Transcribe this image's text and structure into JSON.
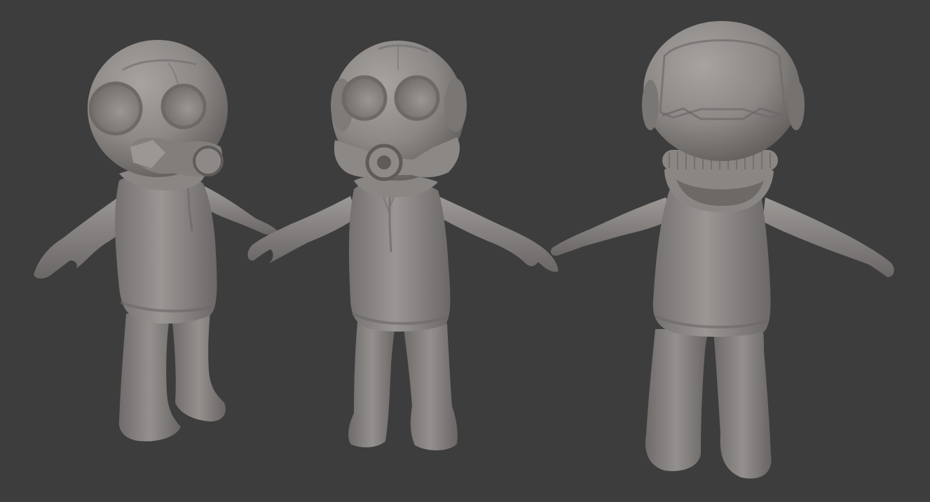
{
  "viewport": {
    "background": "#3d3d3d",
    "material_color": "#8f8b89"
  },
  "figures": [
    {
      "view": "three-quarter-left"
    },
    {
      "view": "front"
    },
    {
      "view": "back"
    }
  ]
}
